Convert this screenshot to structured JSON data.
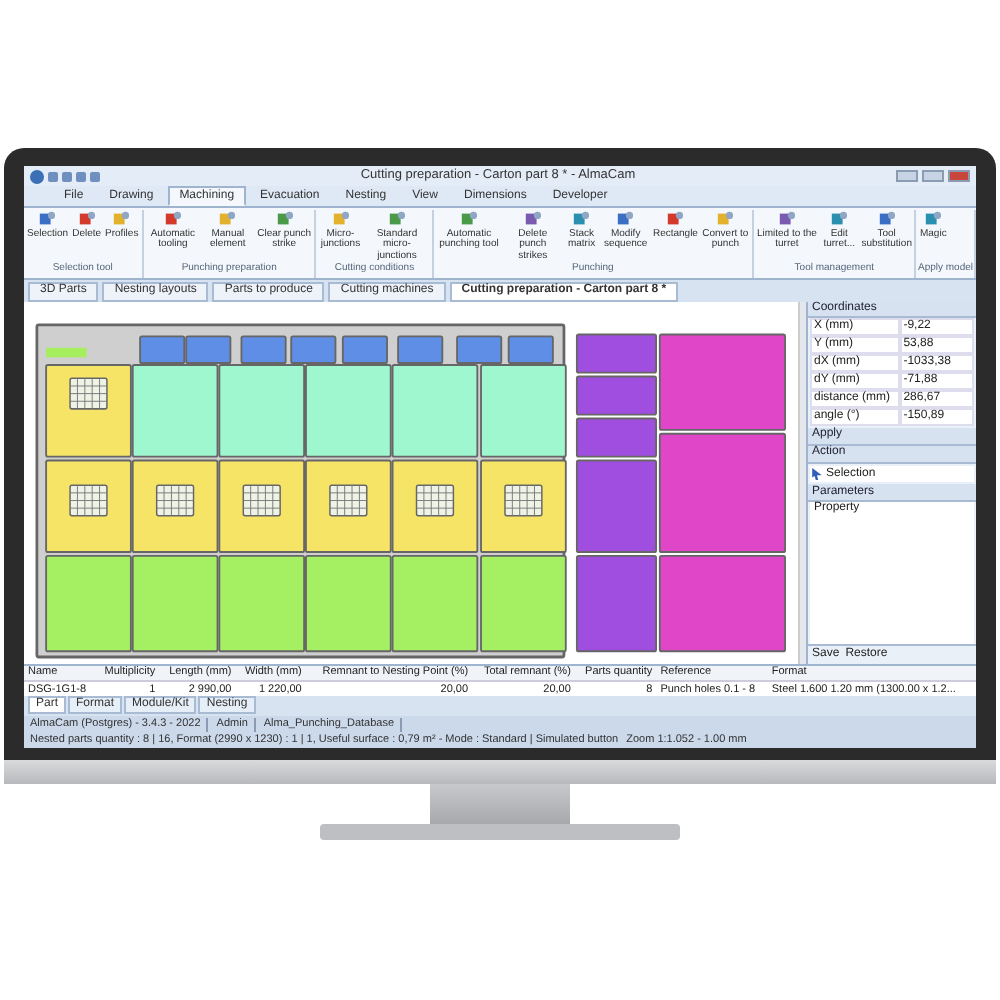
{
  "window": {
    "title": "Cutting preparation - Carton part 8 * - AlmaCam"
  },
  "ribbon_tabs": [
    {
      "label": "File",
      "selected": false
    },
    {
      "label": "Drawing",
      "selected": false
    },
    {
      "label": "Machining",
      "selected": true
    },
    {
      "label": "Evacuation",
      "selected": false
    },
    {
      "label": "Nesting",
      "selected": false
    },
    {
      "label": "View",
      "selected": false
    },
    {
      "label": "Dimensions",
      "selected": false
    },
    {
      "label": "Developer",
      "selected": false
    }
  ],
  "ribbon_groups": [
    {
      "label": "Selection tool",
      "buttons": [
        "Selection",
        "Delete",
        "Profiles"
      ]
    },
    {
      "label": "Punching preparation",
      "buttons": [
        "Automatic tooling",
        "Manual element",
        "Clear punch strike"
      ]
    },
    {
      "label": "Cutting conditions",
      "buttons": [
        "Micro-junctions",
        "Standard micro-junctions"
      ]
    },
    {
      "label": "Punching",
      "buttons": [
        "Automatic punching tool",
        "Delete punch strikes",
        "Stack matrix",
        "Modify sequence",
        "Rectangle",
        "Convert to punch"
      ]
    },
    {
      "label": "Tool management",
      "buttons": [
        "Limited to the turret",
        "Edit turret...",
        "Tool substitution"
      ]
    },
    {
      "label": "Apply model",
      "buttons": [
        "Magic"
      ]
    }
  ],
  "document_tabs": [
    {
      "label": "3D Parts",
      "selected": false
    },
    {
      "label": "Nesting layouts",
      "selected": false
    },
    {
      "label": "Parts to produce",
      "selected": false
    },
    {
      "label": "Cutting machines",
      "selected": false
    },
    {
      "label": "Cutting preparation - Carton part 8 *",
      "selected": true
    }
  ],
  "panel": {
    "coordinates_title": "Coordinates",
    "coordinates": [
      {
        "label": "X (mm)",
        "value": "-9,22"
      },
      {
        "label": "Y (mm)",
        "value": "53,88"
      },
      {
        "label": "dX (mm)",
        "value": "-1033,38"
      },
      {
        "label": "dY (mm)",
        "value": "-71,88"
      },
      {
        "label": "distance (mm)",
        "value": "286,67"
      },
      {
        "label": "angle (°)",
        "value": "-150,89"
      }
    ],
    "apply": "Apply",
    "action_title": "Action",
    "action_item": "Selection",
    "parameters_title": "Parameters",
    "parameters_column": "Property",
    "buttons": [
      "Save",
      "Restore"
    ]
  },
  "table": {
    "columns": [
      "Name",
      "Multiplicity",
      "Length (mm)",
      "Width (mm)",
      "Remnant to Nesting Point (%)",
      "Total remnant (%)",
      "Parts quantity",
      "Reference",
      "Format"
    ],
    "rows": [
      [
        "DSG-1G1-8",
        "1",
        "2 990,00",
        "1 220,00",
        "20,00",
        "20,00",
        "8",
        "Punch holes 0.1 - 8",
        "Steel 1.600 1.20 mm (1300.00 x 1.2..."
      ]
    ]
  },
  "bottom_tabs": [
    {
      "label": "Part",
      "selected": true
    },
    {
      "label": "Format",
      "selected": false
    },
    {
      "label": "Module/Kit",
      "selected": false
    },
    {
      "label": "Nesting",
      "selected": false
    }
  ],
  "status_bar": {
    "left": [
      "AlmaCam (Postgres) - 3.4.3 - 2022",
      "Admin",
      "Alma_Punching_Database"
    ],
    "right": [
      "Nested parts quantity : 8 | 16, Format (2990 x 1230) : 1 | 1, Useful surface : 0,79 m² - Mode : Standard | Simulated button",
      "Zoom 1:1.052 - 1.00 mm"
    ]
  }
}
